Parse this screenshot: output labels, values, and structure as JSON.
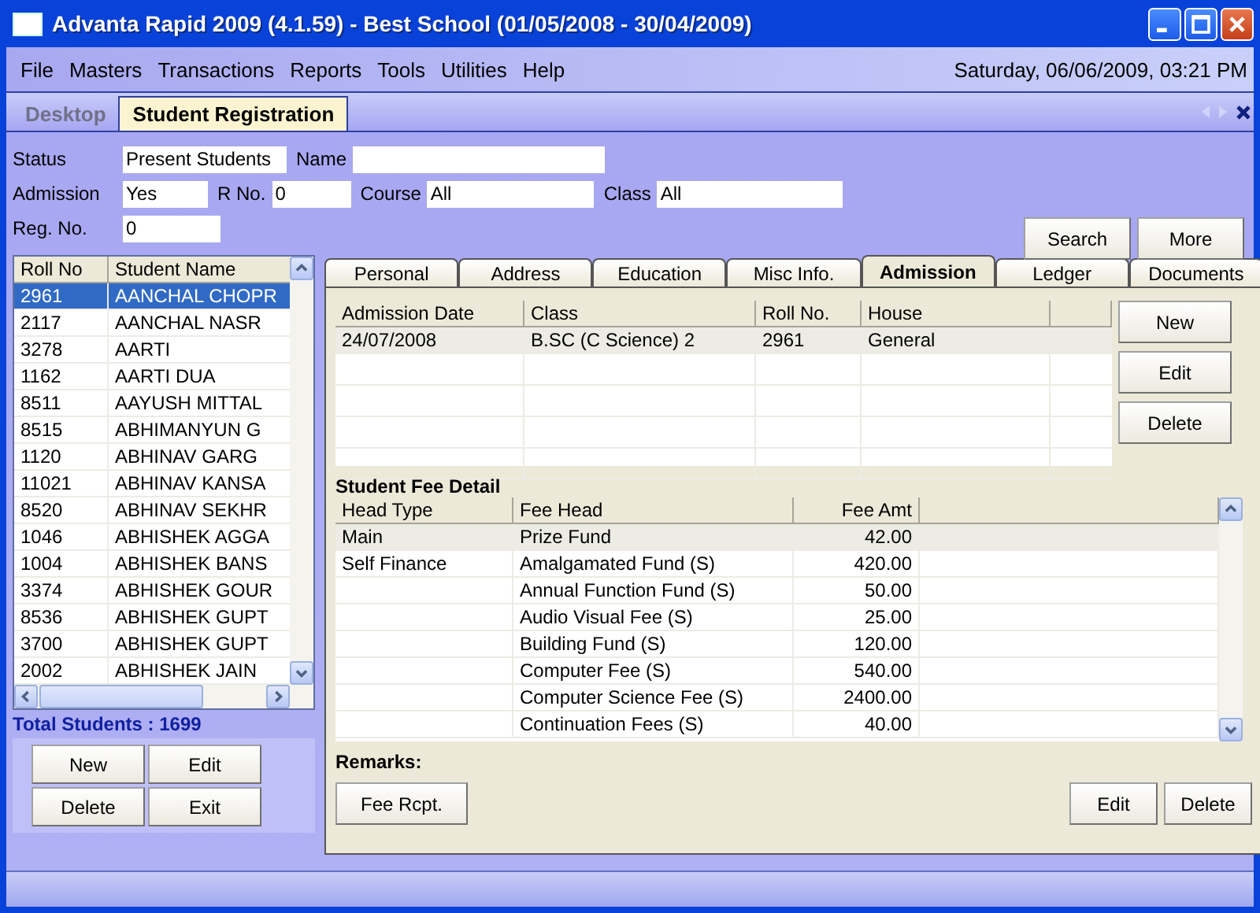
{
  "window": {
    "title": "Advanta Rapid 2009 (4.1.59) - Best School (01/05/2008 - 30/04/2009)"
  },
  "menu": [
    "File",
    "Masters",
    "Transactions",
    "Reports",
    "Tools",
    "Utilities",
    "Help"
  ],
  "datetime": "Saturday, 06/06/2009, 03:21 PM",
  "doc_tabs": [
    {
      "label": "Desktop",
      "selected": false
    },
    {
      "label": "Student Registration",
      "selected": true
    }
  ],
  "filter_rows": [
    {
      "fields": [
        {
          "label": "Status",
          "value": "Present Students"
        },
        {
          "label": "Name"
        }
      ]
    },
    {
      "fields": [
        {
          "label": "Admission",
          "value": "Yes"
        },
        {
          "label": "R No.",
          "value": "0"
        },
        {
          "label": "Course",
          "value": "All"
        },
        {
          "label": "Class",
          "value": "All"
        }
      ]
    },
    {
      "fields": [
        {
          "label": "Reg. No.",
          "value": "0"
        }
      ]
    }
  ],
  "filter_buttons": [
    "Search",
    "More"
  ],
  "students": {
    "columns": [
      "Roll No",
      "Student Name"
    ],
    "rows": [
      {
        "cells": [
          "2961",
          "AANCHAL CHOPR"
        ],
        "selected": true
      },
      {
        "cells": [
          "2117",
          "AANCHAL NASR"
        ],
        "selected": false
      },
      {
        "cells": [
          "3278",
          "AARTI"
        ],
        "selected": false
      },
      {
        "cells": [
          "1162",
          "AARTI  DUA"
        ],
        "selected": false
      },
      {
        "cells": [
          "8511",
          "AAYUSH MITTAL"
        ],
        "selected": false
      },
      {
        "cells": [
          "8515",
          "ABHIMANYUN G"
        ],
        "selected": false
      },
      {
        "cells": [
          "1120",
          "ABHINAV GARG"
        ],
        "selected": false
      },
      {
        "cells": [
          "11021",
          "ABHINAV KANSA"
        ],
        "selected": false
      },
      {
        "cells": [
          "8520",
          "ABHINAV SEKHR"
        ],
        "selected": false
      },
      {
        "cells": [
          "1046",
          "ABHISHEK AGGA"
        ],
        "selected": false
      },
      {
        "cells": [
          "1004",
          "ABHISHEK BANS"
        ],
        "selected": false
      },
      {
        "cells": [
          "3374",
          "ABHISHEK GOUR"
        ],
        "selected": false
      },
      {
        "cells": [
          "8536",
          "ABHISHEK GUPT"
        ],
        "selected": false
      },
      {
        "cells": [
          "3700",
          "ABHISHEK GUPT"
        ],
        "selected": false
      },
      {
        "cells": [
          "2002",
          "ABHISHEK JAIN"
        ],
        "selected": false
      }
    ]
  },
  "total": "Total Students : 1699",
  "list_buttons": [
    "New",
    "Edit",
    "Delete",
    "Exit"
  ],
  "detail_tabs": [
    {
      "label": "Personal",
      "selected": false
    },
    {
      "label": "Address",
      "selected": false
    },
    {
      "label": "Education",
      "selected": false
    },
    {
      "label": "Misc Info.",
      "selected": false
    },
    {
      "label": "Admission",
      "selected": true
    },
    {
      "label": "Ledger",
      "selected": false
    },
    {
      "label": "Documents",
      "selected": false
    }
  ],
  "admissions": {
    "columns": [
      "Admission Date",
      "Class",
      "Roll No.",
      "House"
    ],
    "rows": [
      {
        "cells": [
          "24/07/2008",
          "B.SC (C Science) 2",
          "2961",
          "General"
        ],
        "selected": true
      }
    ]
  },
  "admission_buttons": [
    "New",
    "Edit",
    "Delete"
  ],
  "fee_title": "Student Fee Detail",
  "fees": {
    "columns": [
      "Head Type",
      "Fee Head",
      "Fee Amt"
    ],
    "rows": [
      {
        "cells": [
          "Main",
          "Prize Fund",
          "42.00"
        ],
        "selected": true
      },
      {
        "cells": [
          "Self Finance",
          "Amalgamated Fund (S)",
          "420.00"
        ],
        "selected": false
      },
      {
        "cells": [
          "",
          "Annual Function Fund (S)",
          "50.00"
        ],
        "selected": false
      },
      {
        "cells": [
          "",
          "Audio Visual Fee (S)",
          "25.00"
        ],
        "selected": false
      },
      {
        "cells": [
          "",
          "Building Fund (S)",
          "120.00"
        ],
        "selected": false
      },
      {
        "cells": [
          "",
          "Computer Fee (S)",
          "540.00"
        ],
        "selected": false
      },
      {
        "cells": [
          "",
          "Computer Science Fee (S)",
          "2400.00"
        ],
        "selected": false
      },
      {
        "cells": [
          "",
          "Continuation Fees (S)",
          "40.00"
        ],
        "selected": false
      }
    ]
  },
  "remarks_label": "Remarks:",
  "fee_buttons": [
    "Fee Rcpt.",
    "Edit",
    "Delete"
  ]
}
